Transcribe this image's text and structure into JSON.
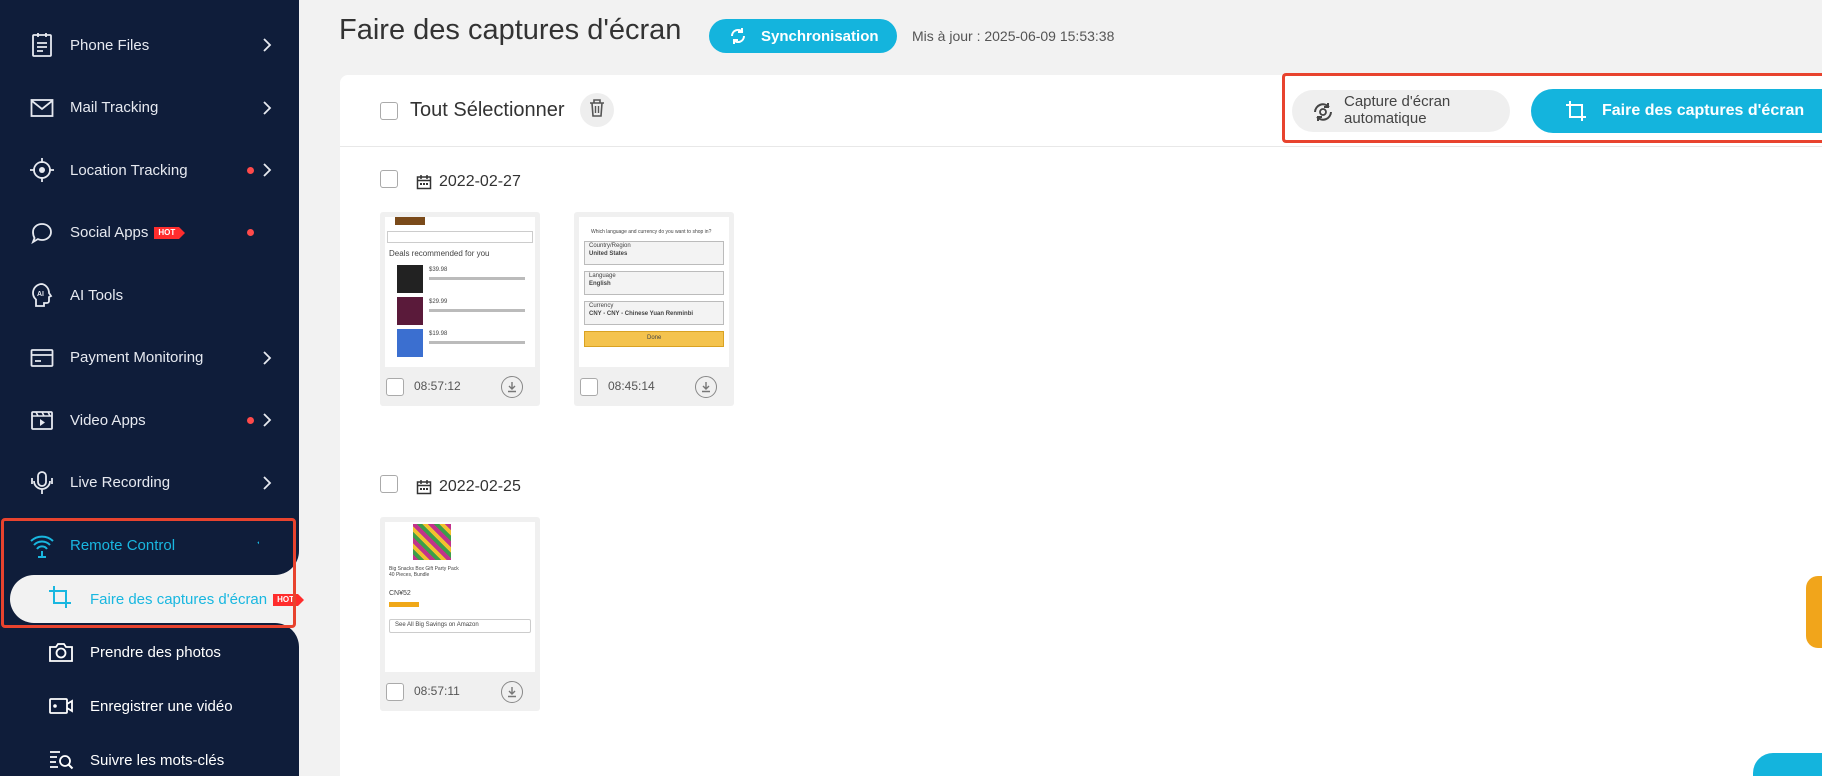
{
  "sidebar": {
    "items": [
      {
        "label": "Phone Files",
        "icon": "file-list-icon",
        "chevron": true,
        "dot": false,
        "hot": false
      },
      {
        "label": "Mail Tracking",
        "icon": "mail-icon",
        "chevron": true,
        "dot": false,
        "hot": false
      },
      {
        "label": "Location Tracking",
        "icon": "location-target-icon",
        "chevron": true,
        "dot": true,
        "hot": false
      },
      {
        "label": "Social Apps",
        "icon": "chat-bubble-icon",
        "chevron": false,
        "dot": true,
        "hot": true
      },
      {
        "label": "AI Tools",
        "icon": "ai-icon",
        "chevron": false,
        "dot": false,
        "hot": false
      },
      {
        "label": "Payment Monitoring",
        "icon": "card-icon",
        "chevron": true,
        "dot": false,
        "hot": false
      },
      {
        "label": "Video Apps",
        "icon": "video-icon",
        "chevron": true,
        "dot": true,
        "hot": false
      },
      {
        "label": "Live Recording",
        "icon": "microphone-icon",
        "chevron": true,
        "dot": false,
        "hot": false
      }
    ],
    "hot_badge": "HOT",
    "remote": {
      "label": "Remote Control",
      "icon": "wifi-remote-icon",
      "sub_items": [
        {
          "label": "Faire des captures d'écran",
          "icon": "crop-icon",
          "active": true,
          "hot": true
        },
        {
          "label": "Prendre des photos",
          "icon": "camera-icon",
          "active": false
        },
        {
          "label": "Enregistrer une vidéo",
          "icon": "video-record-icon",
          "active": false
        },
        {
          "label": "Suivre les mots-clés",
          "icon": "keyword-search-icon",
          "active": false
        }
      ]
    }
  },
  "header": {
    "title": "Faire des captures d'écran",
    "sync_label": "Synchronisation",
    "updated": "Mis à jour : 2025-06-09 15:53:38"
  },
  "toolbar": {
    "select_all": "Tout Sélectionner",
    "auto_capture": "Capture d'écran automatique",
    "take_capture": "Faire des captures d'écran"
  },
  "groups": [
    {
      "date": "2022-02-27",
      "shots": [
        {
          "time": "08:57:12",
          "kind": "recommend",
          "texts": [
            "Deals recommended for you",
            "$39.98",
            "$29.99",
            "$19.98"
          ]
        },
        {
          "time": "08:45:14",
          "kind": "settings",
          "texts": [
            "Which language and currency do you want to shop in?",
            "Country/Region",
            "United States",
            "Language",
            "English",
            "Currency",
            "CNY - CNY - Chinese Yuan Renminbi",
            "Done"
          ]
        }
      ]
    },
    {
      "date": "2022-02-25",
      "shots": [
        {
          "time": "08:57:11",
          "kind": "product",
          "texts": [
            "Big Snacks Box Gift Party Pack 40 Pieces, Bundle",
            "CN¥52",
            "See All Big Savings on Amazon"
          ]
        }
      ]
    }
  ],
  "colors": {
    "sidebar_bg": "#0f1d3a",
    "accent": "#14b4dd",
    "highlight_border": "#e8432e",
    "dot": "#ff4a4a"
  }
}
